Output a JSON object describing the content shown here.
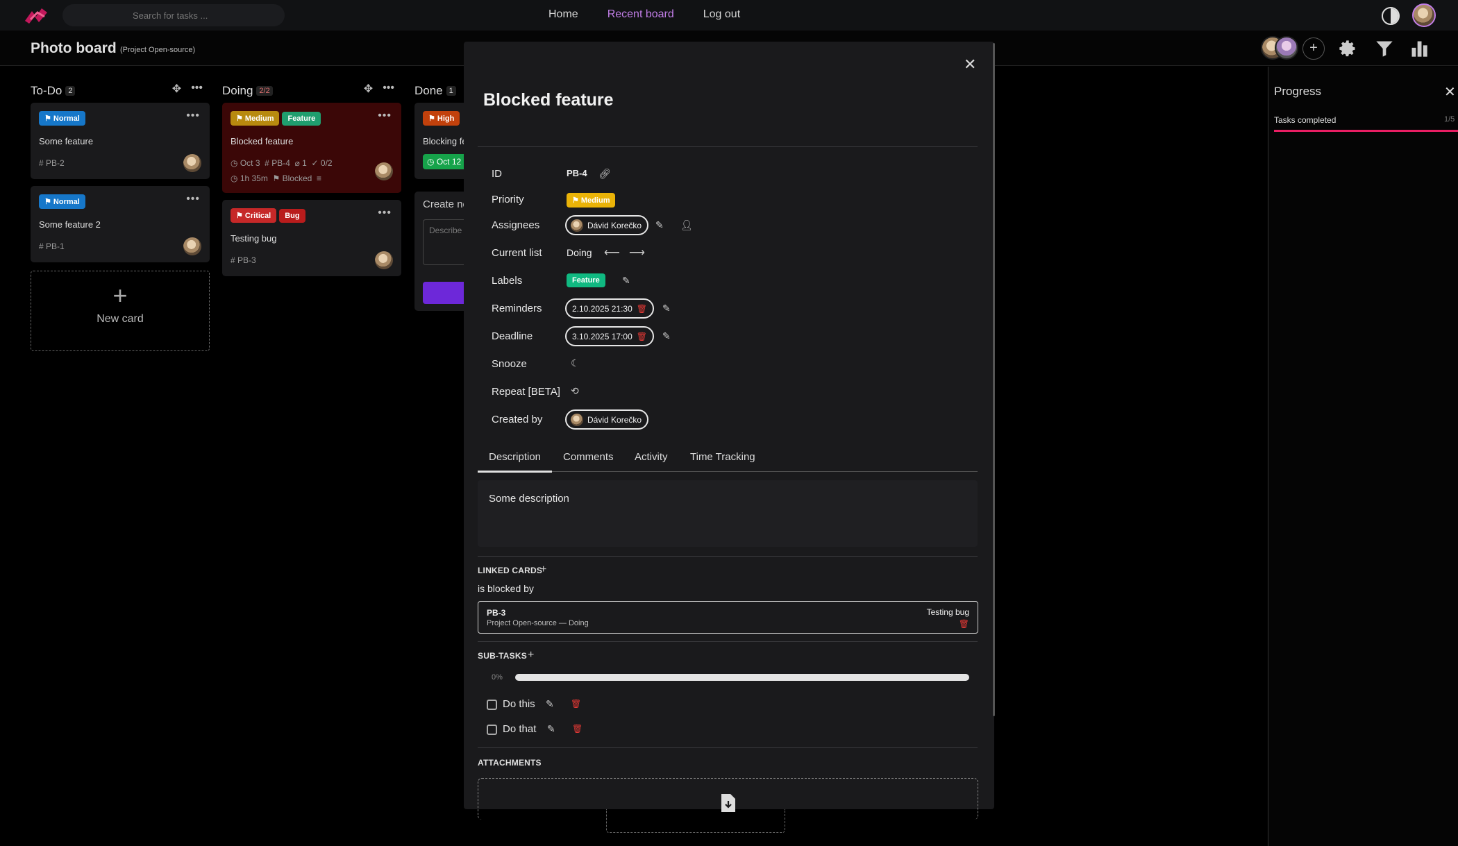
{
  "nav": {
    "search_placeholder": "Search for tasks ...",
    "links": [
      "Home",
      "Recent board",
      "Log out"
    ]
  },
  "board": {
    "title": "Photo board",
    "subtitle": "(Project Open-source)"
  },
  "columns": [
    {
      "title": "To-Do",
      "count": "2",
      "cards": [
        {
          "labels": [
            "Normal"
          ],
          "title": "Some feature",
          "id": "PB-2"
        },
        {
          "labels": [
            "Normal"
          ],
          "title": "Some feature 2",
          "id": "PB-1"
        }
      ]
    },
    {
      "title": "Doing",
      "count": "2/2",
      "cards": [
        {
          "labels": [
            "Medium",
            "Feature"
          ],
          "title": "Blocked feature",
          "date": "Oct 3",
          "id": "PB-4",
          "attachments": "1",
          "subtasks": "0/2",
          "time": "1h 35m",
          "status": "Blocked"
        },
        {
          "labels": [
            "Critical",
            "Bug"
          ],
          "title": "Testing bug",
          "id": "PB-3"
        }
      ]
    },
    {
      "title": "Done",
      "count": "1",
      "cards": [
        {
          "labels": [
            "High"
          ],
          "title": "Blocking fe",
          "date": "Oct 12"
        }
      ],
      "create_label": "Create ne",
      "create_placeholder": "Describe"
    }
  ],
  "new_card_label": "New card",
  "modal": {
    "title": "Blocked feature",
    "props": {
      "id_label": "ID",
      "id_value": "PB-4",
      "priority_label": "Priority",
      "priority_value": "Medium",
      "assignees_label": "Assignees",
      "assignee": "Dávid Korečko",
      "list_label": "Current list",
      "list_value": "Doing",
      "labels_label": "Labels",
      "label_value": "Feature",
      "reminders_label": "Reminders",
      "reminder": "2.10.2025 21:30",
      "deadline_label": "Deadline",
      "deadline": "3.10.2025 17:00",
      "snooze_label": "Snooze",
      "repeat_label": "Repeat [BETA]",
      "created_label": "Created by",
      "created_by": "Dávid Korečko"
    },
    "tabs": [
      "Description",
      "Comments",
      "Activity",
      "Time Tracking"
    ],
    "description": "Some description",
    "linked_header": "LINKED CARDS",
    "relation": "is blocked by",
    "linked_card": {
      "id": "PB-3",
      "path": "Project Open-source — Doing",
      "title": "Testing bug"
    },
    "subtasks_header": "SUB-TASKS",
    "subtasks_progress": "0%",
    "subtasks": [
      "Do this",
      "Do that"
    ],
    "attachments_header": "ATTACHMENTS"
  },
  "progress_panel": {
    "title": "Progress",
    "label": "Tasks completed",
    "count": "1/5",
    "fraction": 0.2
  },
  "colors": {
    "accent": "#c27ee8",
    "progress": "#e91e63"
  }
}
